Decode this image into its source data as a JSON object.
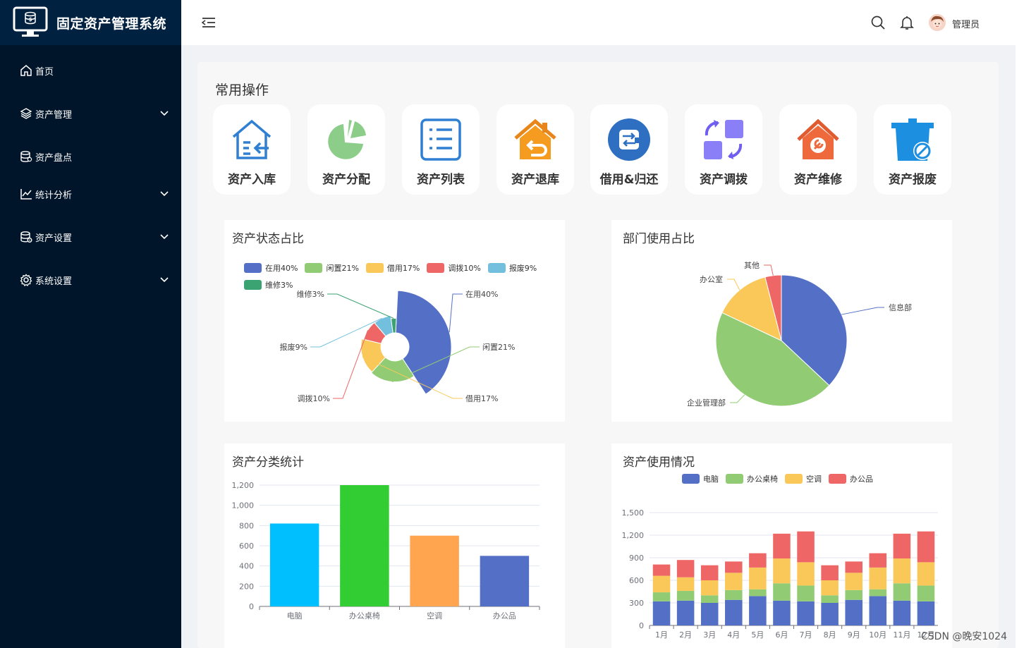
{
  "app": {
    "title": "固定资产管理系统",
    "user_name": "管理员",
    "watermark": "CSDN @晚安1024"
  },
  "sidebar": {
    "items": [
      {
        "label": "首页",
        "icon": "home-icon",
        "has_arrow": false
      },
      {
        "label": "资产管理",
        "icon": "layers-icon",
        "has_arrow": true
      },
      {
        "label": "资产盘点",
        "icon": "database-icon",
        "has_arrow": false
      },
      {
        "label": "统计分析",
        "icon": "line-chart-icon",
        "has_arrow": true
      },
      {
        "label": "资产设置",
        "icon": "database-gear-icon",
        "has_arrow": true
      },
      {
        "label": "系统设置",
        "icon": "gear-icon",
        "has_arrow": true
      }
    ]
  },
  "ops": {
    "title": "常用操作",
    "items": [
      {
        "label": "资产入库",
        "icon": "house-in-icon"
      },
      {
        "label": "资产分配",
        "icon": "pie-icon"
      },
      {
        "label": "资产列表",
        "icon": "list-icon"
      },
      {
        "label": "资产退库",
        "icon": "house-return-icon"
      },
      {
        "label": "借用&归还",
        "icon": "exchange-icon"
      },
      {
        "label": "资产调拨",
        "icon": "transfer-icon"
      },
      {
        "label": "资产维修",
        "icon": "house-repair-icon"
      },
      {
        "label": "资产报废",
        "icon": "trash-icon"
      }
    ]
  },
  "colors": {
    "blue": "#5470c6",
    "green": "#91cc75",
    "yellow": "#fac858",
    "red": "#ee6666",
    "cyan": "#73c0de",
    "teal": "#3ba272"
  },
  "chart_data": [
    {
      "type": "pie",
      "variant": "rose",
      "title": "资产状态占比",
      "legend": [
        "在用40%",
        "闲置21%",
        "借用17%",
        "调拨10%",
        "报废9%",
        "维修3%"
      ],
      "labels": [
        "在用40%",
        "闲置21%",
        "借用17%",
        "调拨10%",
        "报废9%",
        "维修3%"
      ],
      "values": [
        40,
        21,
        17,
        10,
        9,
        3
      ],
      "colors": [
        "#5470c6",
        "#91cc75",
        "#fac858",
        "#ee6666",
        "#73c0de",
        "#3ba272"
      ]
    },
    {
      "type": "pie",
      "title": "部门使用占比",
      "labels": [
        "信息部",
        "企业管理部",
        "办公室",
        "其他"
      ],
      "values": [
        37,
        45,
        14,
        4
      ],
      "colors": [
        "#5470c6",
        "#91cc75",
        "#fac858",
        "#ee6666"
      ]
    },
    {
      "type": "bar",
      "title": "资产分类统计",
      "categories": [
        "电脑",
        "办公桌椅",
        "空调",
        "办公品"
      ],
      "values": [
        820,
        1200,
        700,
        500
      ],
      "colors": [
        "#00bfff",
        "#32cd32",
        "#ffa54f",
        "#5470c6"
      ],
      "y_ticks": [
        "0",
        "200",
        "400",
        "600",
        "800",
        "1,000",
        "1,200"
      ],
      "ylim": [
        0,
        1200
      ]
    },
    {
      "type": "bar",
      "stacked": true,
      "title": "资产使用情况",
      "categories": [
        "1月",
        "2月",
        "3月",
        "4月",
        "5月",
        "6月",
        "7月",
        "8月",
        "9月",
        "10月",
        "11月",
        "12月"
      ],
      "series": [
        {
          "name": "电脑",
          "values": [
            320,
            330,
            300,
            340,
            390,
            330,
            320,
            300,
            340,
            390,
            330,
            320
          ]
        },
        {
          "name": "办公桌椅",
          "values": [
            120,
            130,
            100,
            130,
            90,
            230,
            210,
            100,
            130,
            90,
            230,
            210
          ]
        },
        {
          "name": "空调",
          "values": [
            220,
            180,
            200,
            230,
            290,
            330,
            310,
            200,
            230,
            290,
            330,
            310
          ]
        },
        {
          "name": "办公品",
          "values": [
            150,
            230,
            200,
            150,
            190,
            330,
            410,
            200,
            150,
            190,
            330,
            410
          ]
        }
      ],
      "colors": [
        "#5470c6",
        "#91cc75",
        "#fac858",
        "#ee6666"
      ],
      "y_ticks": [
        "0",
        "300",
        "600",
        "900",
        "1,200",
        "1,500"
      ],
      "ylim": [
        0,
        1500
      ]
    }
  ]
}
